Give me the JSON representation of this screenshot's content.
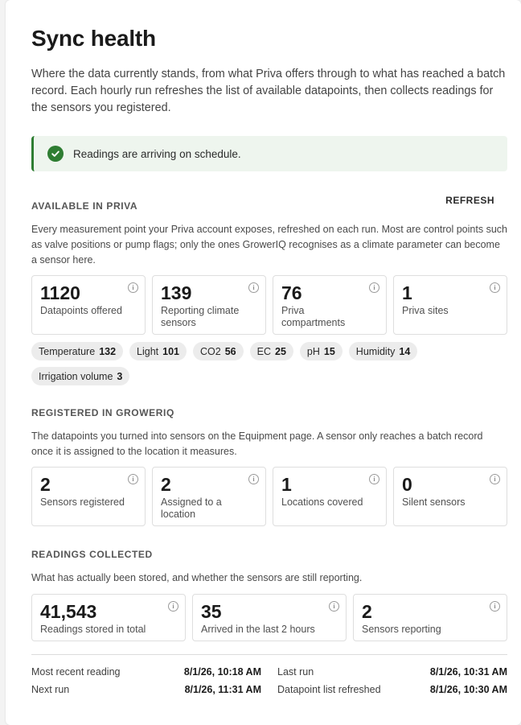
{
  "page": {
    "title": "Sync health",
    "intro": "Where the data currently stands, from what Priva offers through to what has reached a batch record. Each hourly run refreshes the list of available datapoints, then collects readings for the sensors you registered."
  },
  "status": {
    "message": "Readings are arriving on schedule.",
    "color": "#2e7d32"
  },
  "available": {
    "title": "AVAILABLE IN PRIVA",
    "refresh_label": "REFRESH",
    "description": "Every measurement point your Priva account exposes, refreshed on each run. Most are control points such as valve positions or pump flags; only the ones GrowerIQ recognises as a climate parameter can become a sensor here.",
    "tiles": [
      {
        "value": "1120",
        "label": "Datapoints offered"
      },
      {
        "value": "139",
        "label": "Reporting climate sensors"
      },
      {
        "value": "76",
        "label": "Priva compartments"
      },
      {
        "value": "1",
        "label": "Priva sites"
      }
    ],
    "chips": [
      {
        "name": "Temperature",
        "count": "132"
      },
      {
        "name": "Light",
        "count": "101"
      },
      {
        "name": "CO2",
        "count": "56"
      },
      {
        "name": "EC",
        "count": "25"
      },
      {
        "name": "pH",
        "count": "15"
      },
      {
        "name": "Humidity",
        "count": "14"
      },
      {
        "name": "Irrigation volume",
        "count": "3"
      }
    ]
  },
  "registered": {
    "title": "REGISTERED IN GROWERIQ",
    "description": "The datapoints you turned into sensors on the Equipment page. A sensor only reaches a batch record once it is assigned to the location it measures.",
    "tiles": [
      {
        "value": "2",
        "label": "Sensors registered"
      },
      {
        "value": "2",
        "label": "Assigned to a location"
      },
      {
        "value": "1",
        "label": "Locations covered"
      },
      {
        "value": "0",
        "label": "Silent sensors"
      }
    ]
  },
  "readings": {
    "title": "READINGS COLLECTED",
    "description": "What has actually been stored, and whether the sensors are still reporting.",
    "tiles": [
      {
        "value": "41,543",
        "label": "Readings stored in total"
      },
      {
        "value": "35",
        "label": "Arrived in the last 2 hours"
      },
      {
        "value": "2",
        "label": "Sensors reporting"
      }
    ]
  },
  "meta": {
    "most_recent_label": "Most recent reading",
    "most_recent_value": "8/1/26, 10:18 AM",
    "last_run_label": "Last run",
    "last_run_value": "8/1/26, 10:31 AM",
    "next_run_label": "Next run",
    "next_run_value": "8/1/26, 11:31 AM",
    "datapoint_refreshed_label": "Datapoint list refreshed",
    "datapoint_refreshed_value": "8/1/26, 10:30 AM"
  },
  "icons": {
    "status": "check-circle-icon",
    "tile_info": "info-icon"
  }
}
